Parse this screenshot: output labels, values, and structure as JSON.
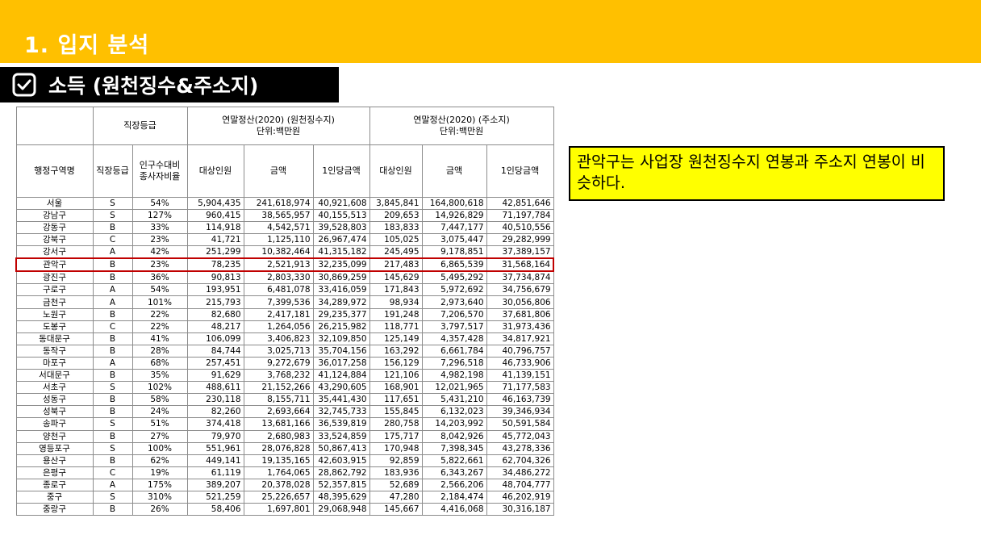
{
  "header": {
    "section_title": "1. 입지 분석",
    "sub_title": "소득 (원천징수&주소지)",
    "band_color": "#ffc000"
  },
  "table": {
    "headers": {
      "grade_group": "직장등급",
      "withholding_group_line1": "연말정산(2020) (원천징수지)",
      "withholding_group_line2": "단위:백만원",
      "address_group_line1": "연말정산(2020) (주소지)",
      "address_group_line2": "단위:백만원",
      "district": "행정구역명",
      "grade": "직장등급",
      "ratio_line1": "인구수대비",
      "ratio_line2": "종사자비율",
      "w_count": "대상인원",
      "w_amount": "금액",
      "w_per_capita": "1인당금액",
      "a_count": "대상인원",
      "a_amount": "금액",
      "a_per_capita": "1인당금액"
    },
    "highlight_color": "#c00000",
    "rows": [
      [
        "서울",
        "S",
        "54%",
        "5,904,435",
        "241,618,974",
        "40,921,608",
        "3,845,841",
        "164,800,618",
        "42,851,646"
      ],
      [
        "강남구",
        "S",
        "127%",
        "960,415",
        "38,565,957",
        "40,155,513",
        "209,653",
        "14,926,829",
        "71,197,784"
      ],
      [
        "강동구",
        "B",
        "33%",
        "114,918",
        "4,542,571",
        "39,528,803",
        "183,833",
        "7,447,177",
        "40,510,556"
      ],
      [
        "강북구",
        "C",
        "23%",
        "41,721",
        "1,125,110",
        "26,967,474",
        "105,025",
        "3,075,447",
        "29,282,999"
      ],
      [
        "강서구",
        "A",
        "42%",
        "251,299",
        "10,382,464",
        "41,315,182",
        "245,495",
        "9,178,851",
        "37,389,157"
      ],
      [
        "관악구",
        "B",
        "23%",
        "78,235",
        "2,521,913",
        "32,235,099",
        "217,483",
        "6,865,539",
        "31,568,164"
      ],
      [
        "광진구",
        "B",
        "36%",
        "90,813",
        "2,803,330",
        "30,869,259",
        "145,629",
        "5,495,292",
        "37,734,874"
      ],
      [
        "구로구",
        "A",
        "54%",
        "193,951",
        "6,481,078",
        "33,416,059",
        "171,843",
        "5,972,692",
        "34,756,679"
      ],
      [
        "금천구",
        "A",
        "101%",
        "215,793",
        "7,399,536",
        "34,289,972",
        "98,934",
        "2,973,640",
        "30,056,806"
      ],
      [
        "노원구",
        "B",
        "22%",
        "82,680",
        "2,417,181",
        "29,235,377",
        "191,248",
        "7,206,570",
        "37,681,806"
      ],
      [
        "도봉구",
        "C",
        "22%",
        "48,217",
        "1,264,056",
        "26,215,982",
        "118,771",
        "3,797,517",
        "31,973,436"
      ],
      [
        "동대문구",
        "B",
        "41%",
        "106,099",
        "3,406,823",
        "32,109,850",
        "125,149",
        "4,357,428",
        "34,817,921"
      ],
      [
        "동작구",
        "B",
        "28%",
        "84,744",
        "3,025,713",
        "35,704,156",
        "163,292",
        "6,661,784",
        "40,796,757"
      ],
      [
        "마포구",
        "A",
        "68%",
        "257,451",
        "9,272,679",
        "36,017,258",
        "156,129",
        "7,296,518",
        "46,733,906"
      ],
      [
        "서대문구",
        "B",
        "35%",
        "91,629",
        "3,768,232",
        "41,124,884",
        "121,106",
        "4,982,198",
        "41,139,151"
      ],
      [
        "서초구",
        "S",
        "102%",
        "488,611",
        "21,152,266",
        "43,290,605",
        "168,901",
        "12,021,965",
        "71,177,583"
      ],
      [
        "성동구",
        "B",
        "58%",
        "230,118",
        "8,155,711",
        "35,441,430",
        "117,651",
        "5,431,210",
        "46,163,739"
      ],
      [
        "성북구",
        "B",
        "24%",
        "82,260",
        "2,693,664",
        "32,745,733",
        "155,845",
        "6,132,023",
        "39,346,934"
      ],
      [
        "송파구",
        "S",
        "51%",
        "374,418",
        "13,681,166",
        "36,539,819",
        "280,758",
        "14,203,992",
        "50,591,584"
      ],
      [
        "양천구",
        "B",
        "27%",
        "79,970",
        "2,680,983",
        "33,524,859",
        "175,717",
        "8,042,926",
        "45,772,043"
      ],
      [
        "영등포구",
        "S",
        "100%",
        "551,961",
        "28,076,828",
        "50,867,413",
        "170,948",
        "7,398,345",
        "43,278,336"
      ],
      [
        "용산구",
        "B",
        "62%",
        "449,141",
        "19,135,165",
        "42,603,915",
        "92,859",
        "5,822,661",
        "62,704,326"
      ],
      [
        "은평구",
        "C",
        "19%",
        "61,119",
        "1,764,065",
        "28,862,792",
        "183,936",
        "6,343,267",
        "34,486,272"
      ],
      [
        "종로구",
        "A",
        "175%",
        "389,207",
        "20,378,028",
        "52,357,815",
        "52,689",
        "2,566,206",
        "48,704,777"
      ],
      [
        "중구",
        "S",
        "310%",
        "521,259",
        "25,226,657",
        "48,395,629",
        "47,280",
        "2,184,474",
        "46,202,919"
      ],
      [
        "중랑구",
        "B",
        "26%",
        "58,406",
        "1,697,801",
        "29,068,948",
        "145,667",
        "4,416,068",
        "30,316,187"
      ]
    ],
    "highlighted_district": "관악구"
  },
  "callout": {
    "text": "관악구는 사업장 원천징수지 연봉과 주소지 연봉이 비슷하다.",
    "background": "#ffff00"
  }
}
